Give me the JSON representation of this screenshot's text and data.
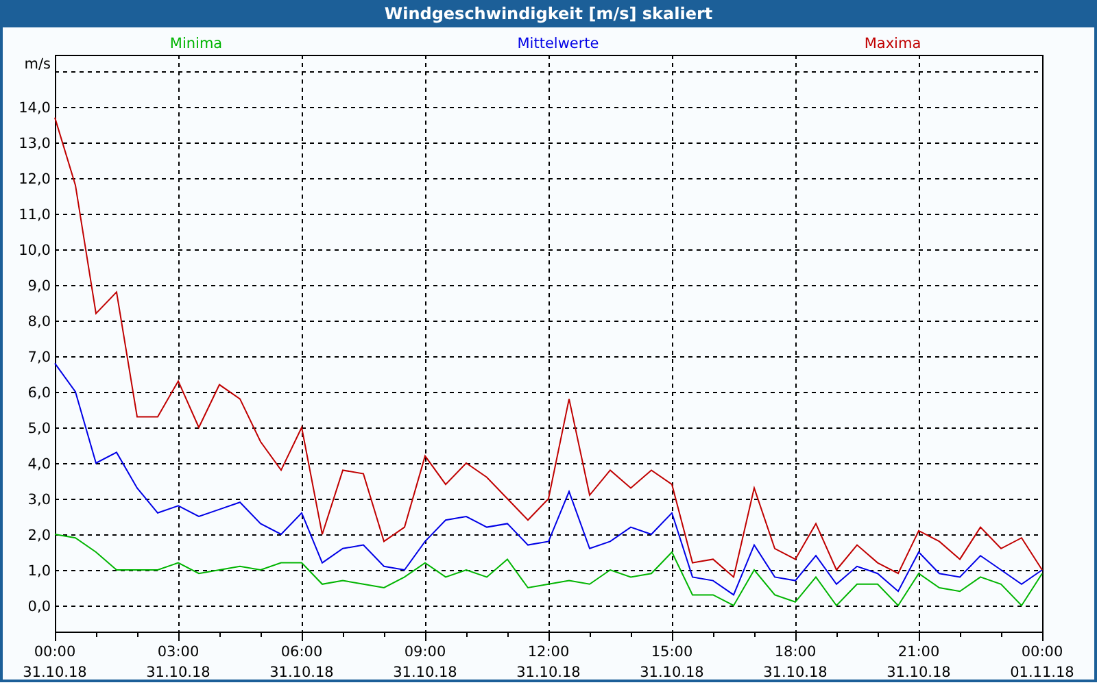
{
  "window": {
    "title": "Windgeschwindigkeit [m/s] skaliert"
  },
  "chart": {
    "chart_data": {
      "type": "line",
      "ylabel": "m/s",
      "categories": [
        "00:00\n31.10.18",
        null,
        null,
        null,
        null,
        null,
        "03:00\n31.10.18",
        null,
        null,
        null,
        null,
        null,
        "06:00\n31.10.18",
        null,
        null,
        null,
        null,
        null,
        "09:00\n31.10.18",
        null,
        null,
        null,
        null,
        null,
        "12:00\n31.10.18",
        null,
        null,
        null,
        null,
        null,
        "15:00\n31.10.18",
        null,
        null,
        null,
        null,
        null,
        "18:00\n31.10.18",
        null,
        null,
        null,
        null,
        null,
        "21:00\n31.10.18",
        null,
        null,
        null,
        null,
        null,
        "00:00\n01.11.18"
      ],
      "series": [
        {
          "name": "Minima",
          "color": "#00b400",
          "values": [
            2.0,
            1.9,
            1.5,
            1.0,
            1.0,
            1.0,
            1.2,
            0.9,
            1.0,
            1.1,
            1.0,
            1.2,
            1.2,
            0.6,
            0.7,
            0.6,
            0.5,
            0.8,
            1.2,
            0.8,
            1.0,
            0.8,
            1.3,
            0.5,
            0.6,
            0.7,
            0.6,
            1.0,
            0.8,
            0.9,
            1.5,
            0.3,
            0.3,
            0.0,
            1.0,
            0.3,
            0.1,
            0.8,
            0.0,
            0.6,
            0.6,
            0.0,
            0.9,
            0.5,
            0.4,
            0.8,
            0.6,
            0.0,
            0.9
          ]
        },
        {
          "name": "Mittelwerte",
          "color": "#0000e6",
          "values": [
            6.8,
            6.0,
            4.0,
            4.3,
            3.3,
            2.6,
            2.8,
            2.5,
            2.7,
            2.9,
            2.3,
            2.0,
            2.6,
            1.2,
            1.6,
            1.7,
            1.1,
            1.0,
            1.8,
            2.4,
            2.5,
            2.2,
            2.3,
            1.7,
            1.8,
            3.2,
            1.6,
            1.8,
            2.2,
            2.0,
            2.6,
            0.8,
            0.7,
            0.3,
            1.7,
            0.8,
            0.7,
            1.4,
            0.6,
            1.1,
            0.9,
            0.4,
            1.5,
            0.9,
            0.8,
            1.4,
            1.0,
            0.6,
            1.0
          ]
        },
        {
          "name": "Maxima",
          "color": "#c00000",
          "values": [
            13.7,
            11.8,
            8.2,
            8.8,
            5.3,
            5.3,
            6.3,
            5.0,
            6.2,
            5.8,
            4.6,
            3.8,
            5.0,
            2.0,
            3.8,
            3.7,
            1.8,
            2.2,
            4.2,
            3.4,
            4.0,
            3.6,
            3.0,
            2.4,
            3.0,
            5.8,
            3.1,
            3.8,
            3.3,
            3.8,
            3.4,
            1.2,
            1.3,
            0.8,
            3.3,
            1.6,
            1.3,
            2.3,
            1.0,
            1.7,
            1.2,
            0.9,
            2.1,
            1.8,
            1.3,
            2.2,
            1.6,
            1.9,
            1.0
          ]
        }
      ],
      "ylim": [
        -0.73,
        15.46
      ],
      "grid": true,
      "yticks": [
        {
          "value": 0,
          "label": "0,0"
        },
        {
          "value": 1,
          "label": "1,0"
        },
        {
          "value": 2,
          "label": "2,0"
        },
        {
          "value": 3,
          "label": "3,0"
        },
        {
          "value": 4,
          "label": "4,0"
        },
        {
          "value": 5,
          "label": "5,0"
        },
        {
          "value": 6,
          "label": "6,0"
        },
        {
          "value": 7,
          "label": "7,0"
        },
        {
          "value": 8,
          "label": "8,0"
        },
        {
          "value": 9,
          "label": "9,0"
        },
        {
          "value": 10,
          "label": "10,0"
        },
        {
          "value": 11,
          "label": "11,0"
        },
        {
          "value": 12,
          "label": "12,0"
        },
        {
          "value": 13,
          "label": "13,0"
        },
        {
          "value": 14,
          "label": "14,0"
        }
      ]
    }
  }
}
